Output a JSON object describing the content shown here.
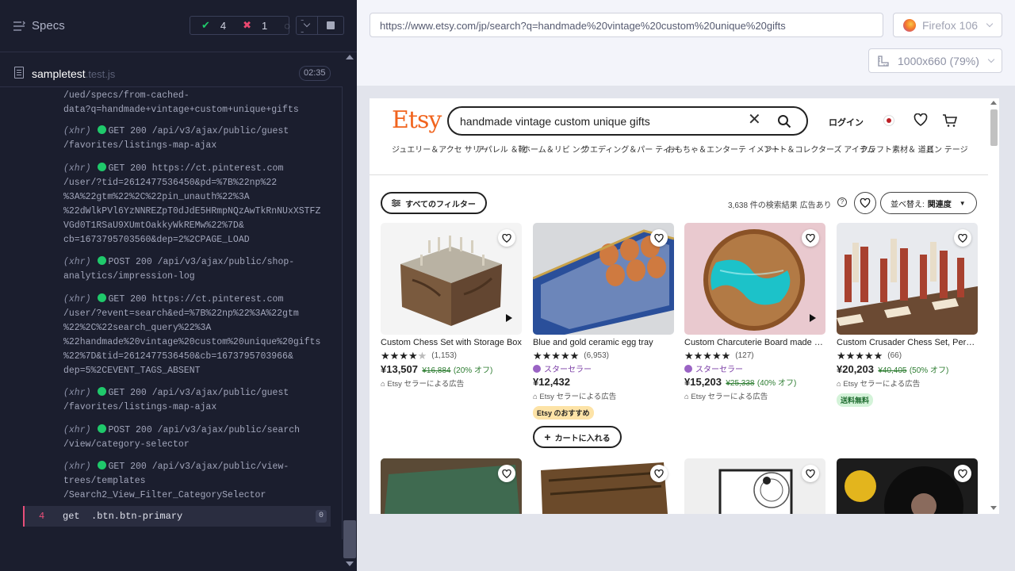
{
  "runner": {
    "specs_label": "Specs",
    "stats": {
      "passed": "4",
      "failed": "1",
      "pending": "--"
    },
    "file": {
      "name": "sampletest",
      "ext": ".test.js",
      "duration": "02:35"
    },
    "log": [
      {
        "type": "",
        "text": "/ued/specs/from-cached-\ndata?q=handmade+vintage+custom+unique+gifts",
        "top": 0
      },
      {
        "type": "(xhr)",
        "text": "GET 200 /api/v3/ajax/public/guest\n/favorites/listings-map-ajax"
      },
      {
        "type": "(xhr)",
        "text": "GET 200 https://ct.pinterest.com\n/user/?tid=2612477536450&pd=%7B%22np%22\n%3A%22gtm%22%2C%22pin_unauth%22%3A\n%22dWlkPVl6YzNNREZpT0dJdE5HRmpNQzAwTkRnNUxXSTFZ\nVGd0T1RSaU9XUmtOakkyWkREMw%22%7D&\ncb=1673795703560&dep=2%2CPAGE_LOAD"
      },
      {
        "type": "(xhr)",
        "text": "POST 200 /api/v3/ajax/public/shop-\nanalytics/impression-log"
      },
      {
        "type": "(xhr)",
        "text": "GET 200 https://ct.pinterest.com\n/user/?event=search&ed=%7B%22np%22%3A%22gtm\n%22%2C%22search_query%22%3A\n%22handmade%20vintage%20custom%20unique%20gifts\n%22%7D&tid=2612477536450&cb=1673795703966&\ndep=5%2CEVENT_TAGS_ABSENT"
      },
      {
        "type": "(xhr)",
        "text": "GET 200 /api/v3/ajax/public/guest\n/favorites/listings-map-ajax"
      },
      {
        "type": "(xhr)",
        "text": "POST 200 /api/v3/ajax/public/search\n/view/category-selector"
      },
      {
        "type": "(xhr)",
        "text": "GET 200 /api/v3/ajax/public/view-\ntrees/templates\n/Search2_View_Filter_CategorySelector"
      }
    ],
    "active_command": {
      "number": "4",
      "name": "get",
      "selector": ".btn.btn-primary",
      "count": "0"
    }
  },
  "browser": {
    "url": "https://www.etsy.com/jp/search?q=handmade%20vintage%20custom%20unique%20gifts",
    "name": "Firefox 106",
    "viewport": "1000x660",
    "zoom": "(79%)"
  },
  "etsy": {
    "logo": "Etsy",
    "search_value": "handmade vintage custom unique gifts",
    "login": "ログイン",
    "categories": [
      "ジュエリー＆アクセ\nサリー",
      "アパレル\n＆靴",
      "ホーム＆リビ\nング",
      "ウエディング＆パー\nティー",
      "おもちゃ＆エンターテ\nイメント",
      "アート＆コレクターズ\nアイテム",
      "クラフト素材＆\n道具",
      "ビン\nテージ"
    ],
    "filter_button": "すべてのフィルター",
    "results_text": "3,638 件の検索結果 広告あり",
    "sort_label": "並べ替え:",
    "sort_value": "関連度",
    "products": [
      {
        "title": "Custom Chess Set with Storage Box",
        "rating": 4.5,
        "reviews": "(1,153)",
        "star_seller": "",
        "price": "¥13,507",
        "old_price": "¥16,884",
        "discount": "(20% オフ)",
        "ad": "Etsy セラーによる広告",
        "badge": "",
        "add_to_cart": ""
      },
      {
        "title": "Blue and gold ceramic egg tray",
        "rating": 5,
        "reviews": "(6,953)",
        "star_seller": "スターセラー",
        "price": "¥12,432",
        "old_price": "",
        "discount": "",
        "ad": "Etsy セラーによる広告",
        "badge": "Etsy のおすすめ",
        "add_to_cart": "カートに入れる"
      },
      {
        "title": "Custom Charcuterie Board made of olive wood",
        "rating": 5,
        "reviews": "(127)",
        "star_seller": "スターセラー",
        "price": "¥15,203",
        "old_price": "¥25,338",
        "discount": "(40% オフ)",
        "ad": "Etsy セラーによる広告",
        "badge": "",
        "add_to_cart": ""
      },
      {
        "title": "Custom Crusader Chess Set, Personalized",
        "rating": 5,
        "reviews": "(66)",
        "star_seller": "",
        "price": "¥20,203",
        "old_price": "¥40,405",
        "discount": "(50% オフ)",
        "ad": "Etsy セラーによる広告",
        "badge_green": "送料無料",
        "add_to_cart": ""
      }
    ]
  }
}
